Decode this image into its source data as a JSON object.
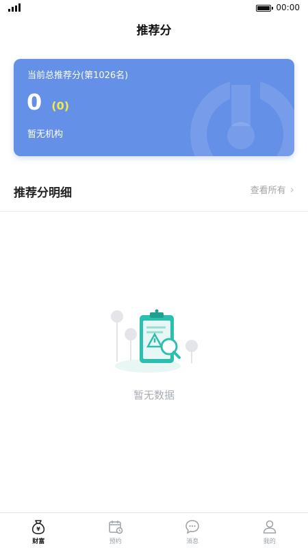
{
  "status_bar": {
    "time": "00:00"
  },
  "header": {
    "title": "推荐分"
  },
  "score_card": {
    "subtitle": "当前总推荐分(第1026名)",
    "score": "0",
    "delta": "(0)",
    "organization": "暂无机构"
  },
  "detail_section": {
    "title": "推荐分明细",
    "view_all": "查看所有"
  },
  "empty_state": {
    "text": "暂无数据"
  },
  "tab_bar": {
    "active_index": 0,
    "items": [
      {
        "label": "财富",
        "icon": "money-bag-icon"
      },
      {
        "label": "预约",
        "icon": "calendar-icon"
      },
      {
        "label": "消息",
        "icon": "chat-bubble-icon"
      },
      {
        "label": "我的",
        "icon": "user-icon"
      }
    ]
  },
  "colors": {
    "card_bg": "#6590e7",
    "delta_yellow": "#f6e84a",
    "empty_accent": "#2cbfb0"
  }
}
